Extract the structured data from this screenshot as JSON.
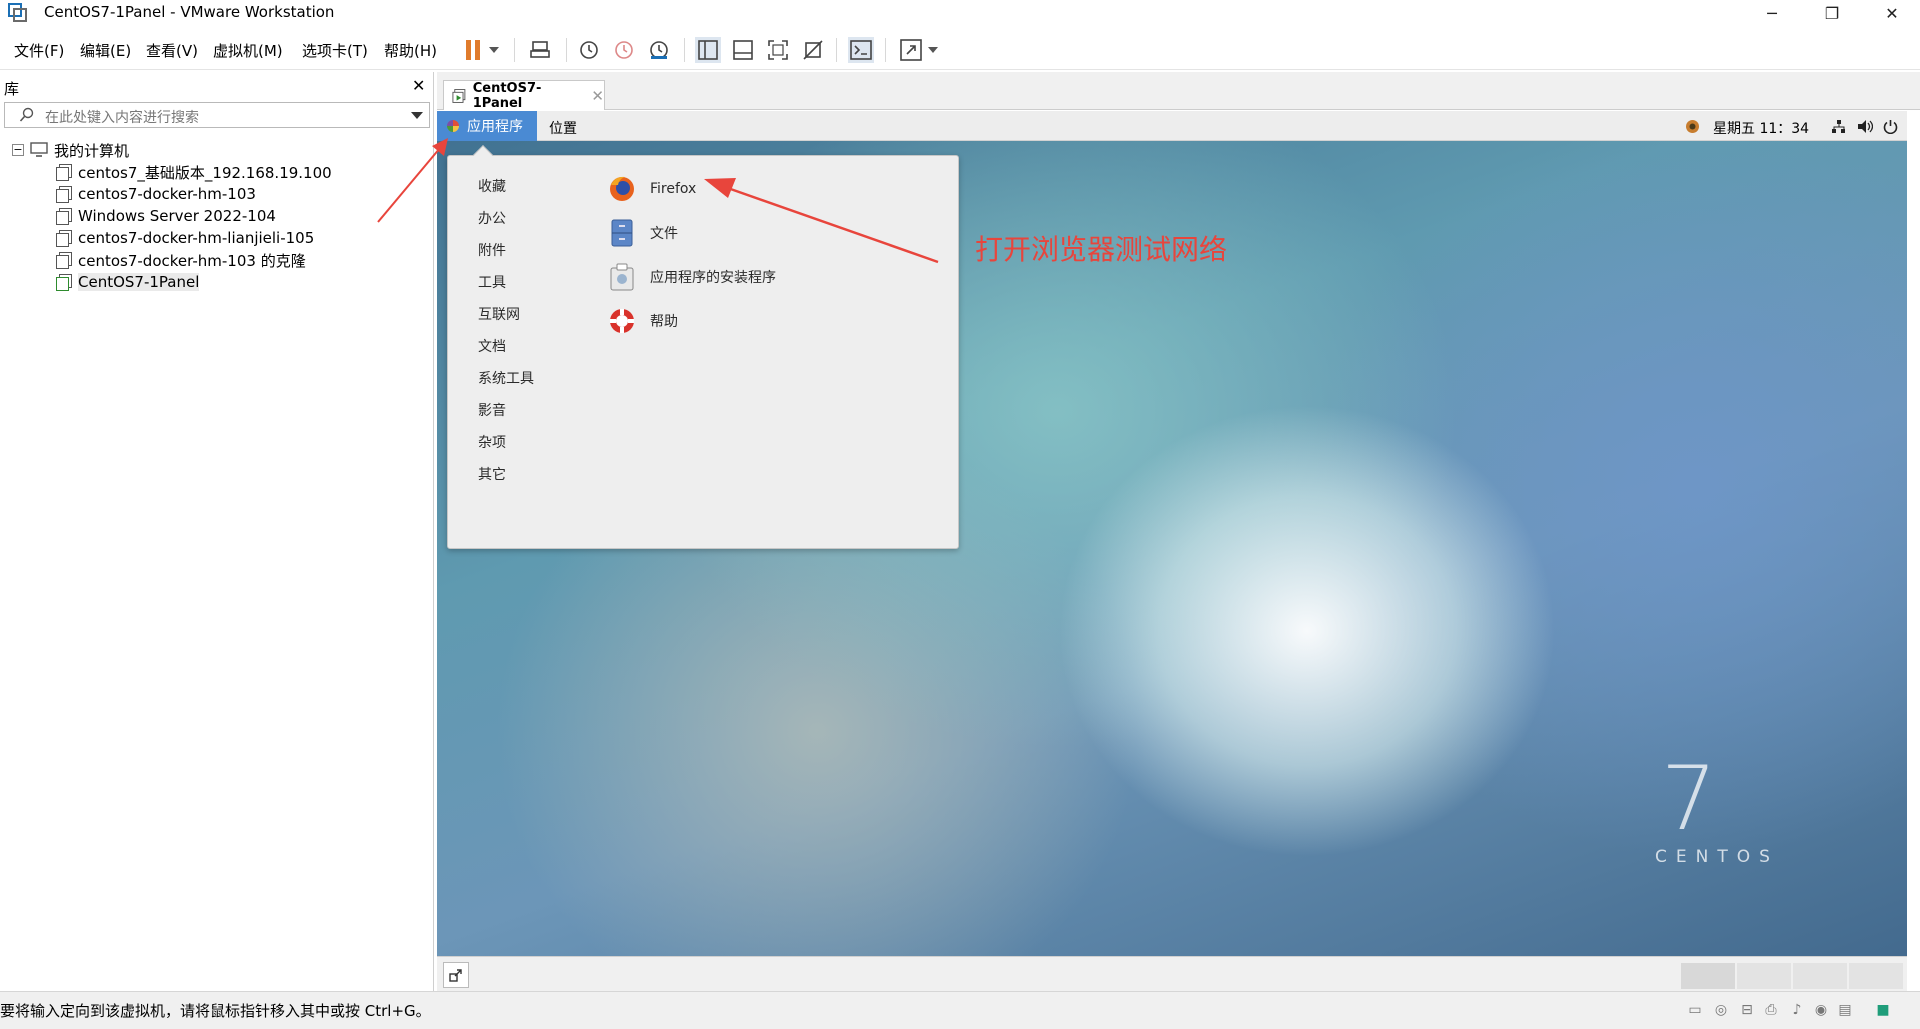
{
  "window": {
    "title": "CentOS7-1Panel - VMware Workstation",
    "minimize": "─",
    "restore": "❐",
    "close": "✕"
  },
  "menubar": {
    "items": [
      "文件(F)",
      "编辑(E)",
      "查看(V)",
      "虚拟机(M)",
      "选项卡(T)",
      "帮助(H)"
    ]
  },
  "library": {
    "title": "库",
    "close": "✕",
    "search_placeholder": "在此处键入内容进行搜索",
    "root": "我的计算机",
    "vms": [
      "centos7_基础版本_192.168.19.100",
      "centos7-docker-hm-103",
      "Windows Server 2022-104",
      "centos7-docker-hm-lianjieli-105",
      "centos7-docker-hm-103 的克隆",
      "CentOS7-1Panel"
    ],
    "selected_vm": "CentOS7-1Panel"
  },
  "vm_tab": {
    "label": "CentOS7-1Panel",
    "close": "✕"
  },
  "gnome": {
    "applications": "应用程序",
    "places": "位置",
    "clock": "星期五 11：34"
  },
  "app_menu": {
    "categories": [
      "收藏",
      "办公",
      "附件",
      "工具",
      "互联网",
      "文档",
      "系统工具",
      "影音",
      "杂项",
      "其它"
    ],
    "apps": [
      "Firefox",
      "文件",
      "应用程序的安装程序",
      "帮助"
    ]
  },
  "annotation": "打开浏览器测试网络",
  "wallpaper": {
    "number": "7",
    "word": "CENTOS"
  },
  "statusbar": {
    "message": "要将输入定向到该虚拟机，请将鼠标指针移入其中或按 Ctrl+G。"
  },
  "colors": {
    "accent": "#4a8ad3",
    "annotation": "#e8453c",
    "pause": "#e07b2c"
  }
}
